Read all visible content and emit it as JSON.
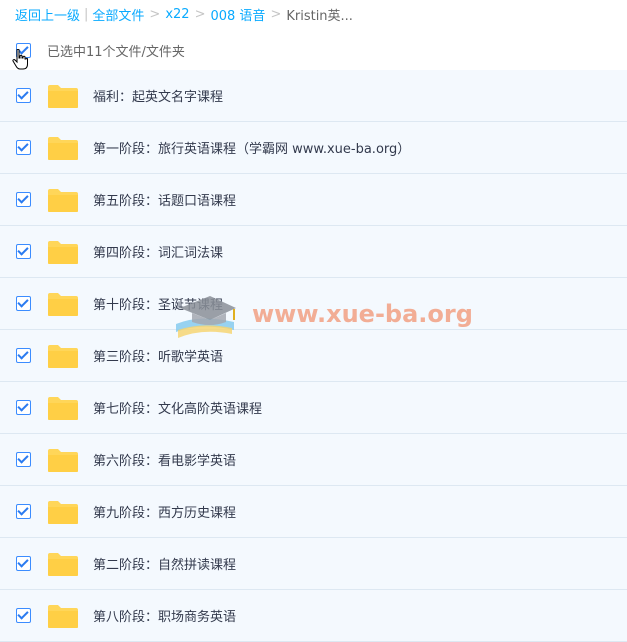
{
  "breadcrumb": {
    "back_label": "返回上一级",
    "all_files_label": "全部文件",
    "path": [
      "x22",
      "008 语音"
    ],
    "current": "Kristin英..."
  },
  "selection": {
    "text": "已选中11个文件/文件夹"
  },
  "files": [
    {
      "name": "福利：起英文名字课程"
    },
    {
      "name": "第一阶段：旅行英语课程（学霸网 www.xue-ba.org）"
    },
    {
      "name": "第五阶段：话题口语课程"
    },
    {
      "name": "第四阶段：词汇词法课"
    },
    {
      "name": "第十阶段：圣诞节课程"
    },
    {
      "name": "第三阶段：听歌学英语"
    },
    {
      "name": "第七阶段：文化高阶英语课程"
    },
    {
      "name": "第六阶段：看电影学英语"
    },
    {
      "name": "第九阶段：西方历史课程"
    },
    {
      "name": "第二阶段：自然拼读课程"
    },
    {
      "name": "第八阶段：职场商务英语"
    }
  ],
  "watermark": {
    "text": "www.xue-ba.org"
  },
  "colors": {
    "link": "#09aaff",
    "folder": "#ffd659",
    "row_bg": "#f4f9fe",
    "checkbox": "#3b8cff"
  }
}
